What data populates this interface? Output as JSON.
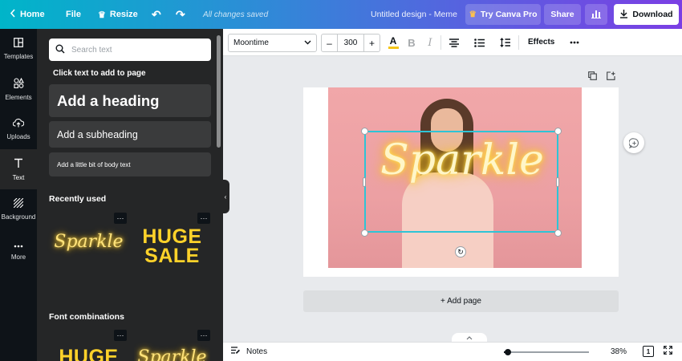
{
  "topbar": {
    "home": "Home",
    "file": "File",
    "resize": "Resize",
    "saved_status": "All changes saved",
    "design_title": "Untitled design - Meme",
    "try_pro": "Try Canva Pro",
    "share": "Share",
    "download": "Download"
  },
  "rail": {
    "items": [
      {
        "label": "Templates",
        "icon": "templates-icon"
      },
      {
        "label": "Elements",
        "icon": "elements-icon"
      },
      {
        "label": "Uploads",
        "icon": "uploads-icon"
      },
      {
        "label": "Text",
        "icon": "text-icon",
        "active": true
      },
      {
        "label": "Background",
        "icon": "background-icon"
      },
      {
        "label": "More",
        "icon": "more-icon"
      }
    ]
  },
  "panel": {
    "search_placeholder": "Search text",
    "hint": "Click text to add to page",
    "add_heading": "Add a heading",
    "add_subheading": "Add a subheading",
    "add_body": "Add a little bit of body text",
    "recently_used": "Recently used",
    "recent_1": "Sparkle",
    "recent_2": "HUGE SALE",
    "font_combinations": "Font combinations",
    "combo_1": "HUGE",
    "combo_2": "Sparkle",
    "more_glyph": "···"
  },
  "toolbar": {
    "font": "Moontime",
    "size": "300",
    "effects": "Effects",
    "text_color": "#f5c518"
  },
  "canvas": {
    "text": "Sparkle",
    "add_page": "+ Add page"
  },
  "bottombar": {
    "notes": "Notes",
    "zoom": "38%",
    "zoom_fraction": 0.05,
    "page_count": "1"
  }
}
